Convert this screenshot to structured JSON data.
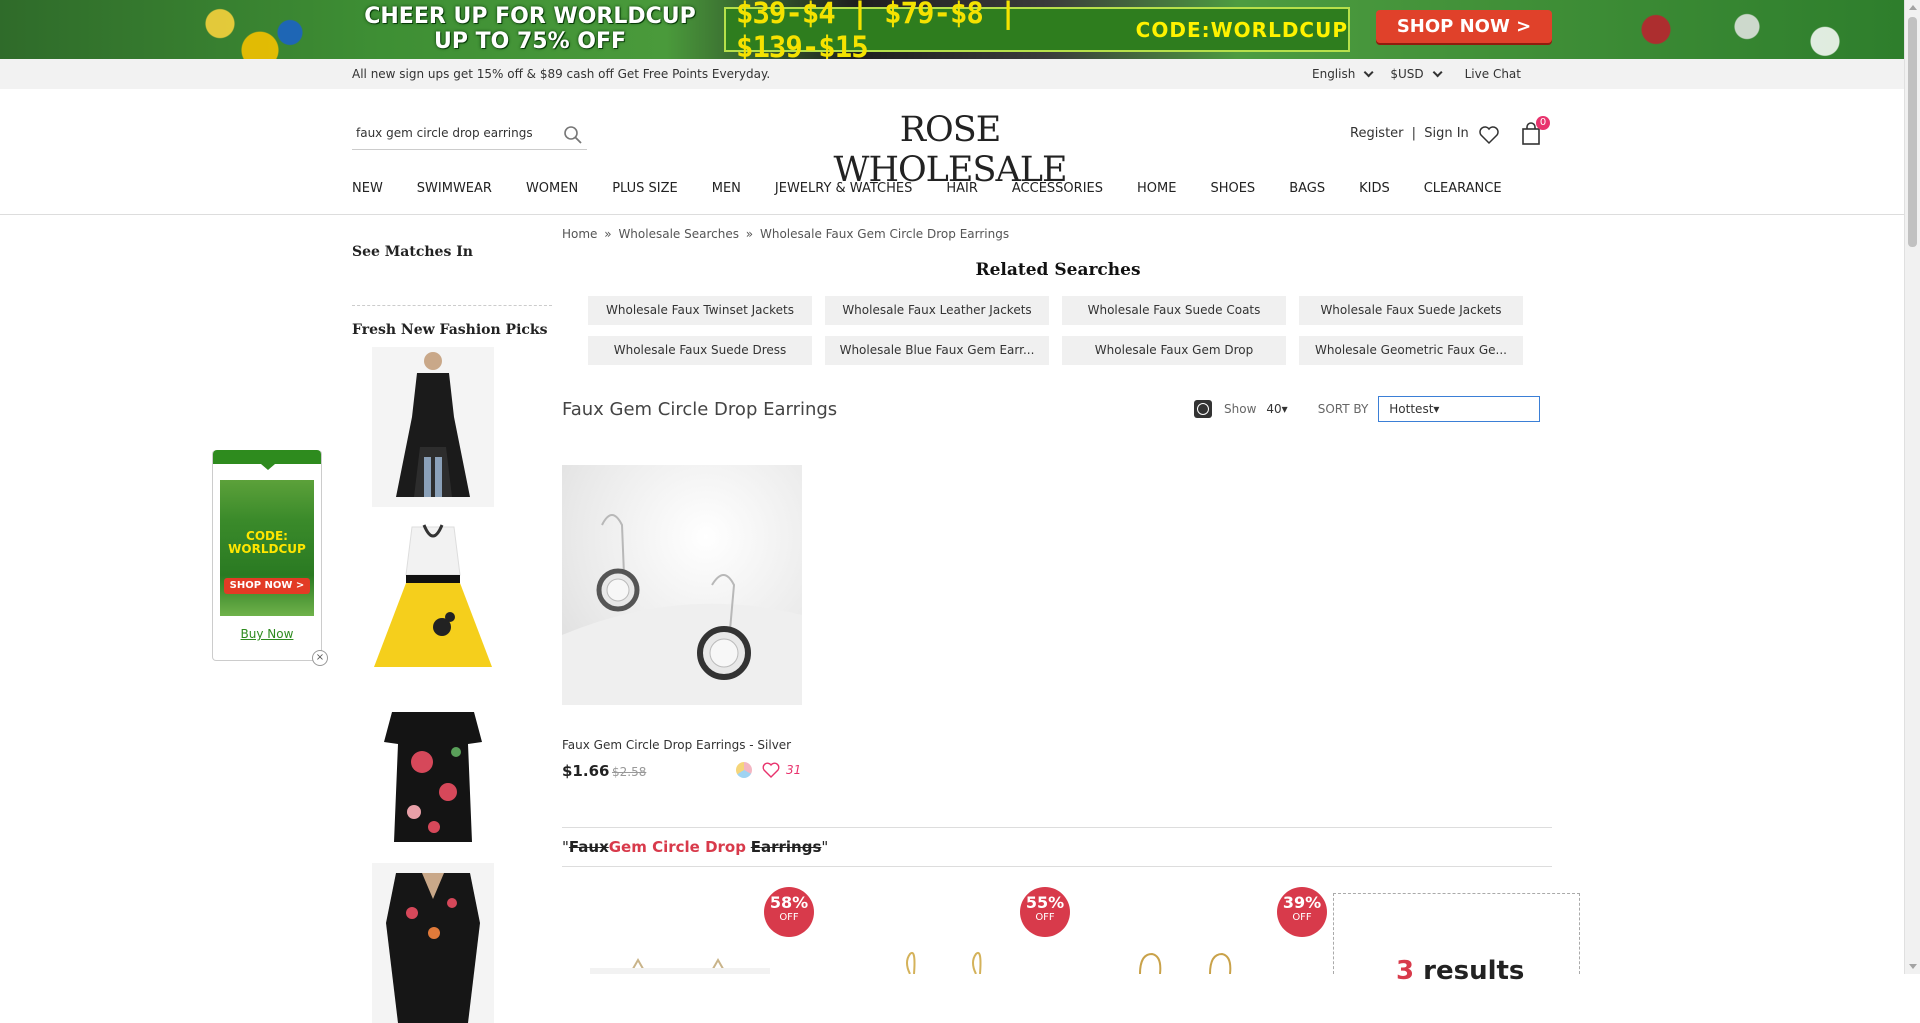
{
  "banner": {
    "headline": "CHEER UP FOR WORLDCUP UP TO 75% OFF",
    "prices": "$39-$4 | $79-$8 | $139-$15",
    "code": "CODE:WORLDCUP",
    "shop_now": "SHOP NOW >"
  },
  "promo": {
    "text": "All new sign ups get 15% off & $89 cash off  Get Free Points Everyday.",
    "language": "English",
    "currency": "$USD",
    "live_chat": "Live Chat"
  },
  "header": {
    "search_value": "faux gem circle drop earrings",
    "logo": "ROSE WHOLESALE",
    "register": "Register",
    "separator": "|",
    "sign_in": "Sign In",
    "cart_count": "0"
  },
  "nav": {
    "items": [
      "NEW",
      "SWIMWEAR",
      "WOMEN",
      "PLUS SIZE",
      "MEN",
      "JEWELRY & WATCHES",
      "HAIR",
      "ACCESSORIES",
      "HOME",
      "SHOES",
      "BAGS",
      "KIDS",
      "CLEARANCE"
    ]
  },
  "sidebar": {
    "see_matches": "See Matches In",
    "fresh_picks": "Fresh New Fashion Picks"
  },
  "float_ad": {
    "code_text": "CODE: WORLDCUP",
    "shop_now": "SHOP NOW >",
    "buy_now": "Buy Now",
    "close": "×"
  },
  "breadcrumb": {
    "home": "Home",
    "sep": "»",
    "wholesale_searches": "Wholesale Searches",
    "current": "Wholesale Faux Gem Circle Drop Earrings"
  },
  "related": {
    "title": "Related Searches",
    "items": [
      "Wholesale Faux Twinset Jackets",
      "Wholesale Faux Leather Jackets",
      "Wholesale Faux Suede Coats",
      "Wholesale Faux Suede Jackets",
      "Wholesale Faux Suede Dress",
      "Wholesale Blue Faux Gem Earr...",
      "Wholesale Faux Gem Drop",
      "Wholesale Geometric Faux Ge..."
    ]
  },
  "results": {
    "title": "Faux Gem Circle Drop Earrings",
    "show_label": "Show",
    "show_value": "40",
    "sort_label": "SORT BY",
    "sort_value": "Hottest"
  },
  "product": {
    "name": "Faux Gem Circle Drop Earrings - Silver",
    "price": "$1.66",
    "old_price": "$2.58",
    "likes": "31"
  },
  "nomatch": {
    "quote_open": "\"",
    "faux": "Faux",
    "gem_circle_drop": "Gem Circle Drop",
    "earrings": "Earrings",
    "quote_close": "\""
  },
  "discounts": [
    {
      "pct": "58%",
      "off": "OFF"
    },
    {
      "pct": "55%",
      "off": "OFF"
    },
    {
      "pct": "39%",
      "off": "OFF"
    }
  ],
  "results_box": {
    "count": "3",
    "label": " results"
  },
  "colors": {
    "accent_red": "#d83a4b",
    "pink": "#e8336d",
    "banner_green": "#2e7d1e",
    "banner_button": "#e0412a"
  }
}
